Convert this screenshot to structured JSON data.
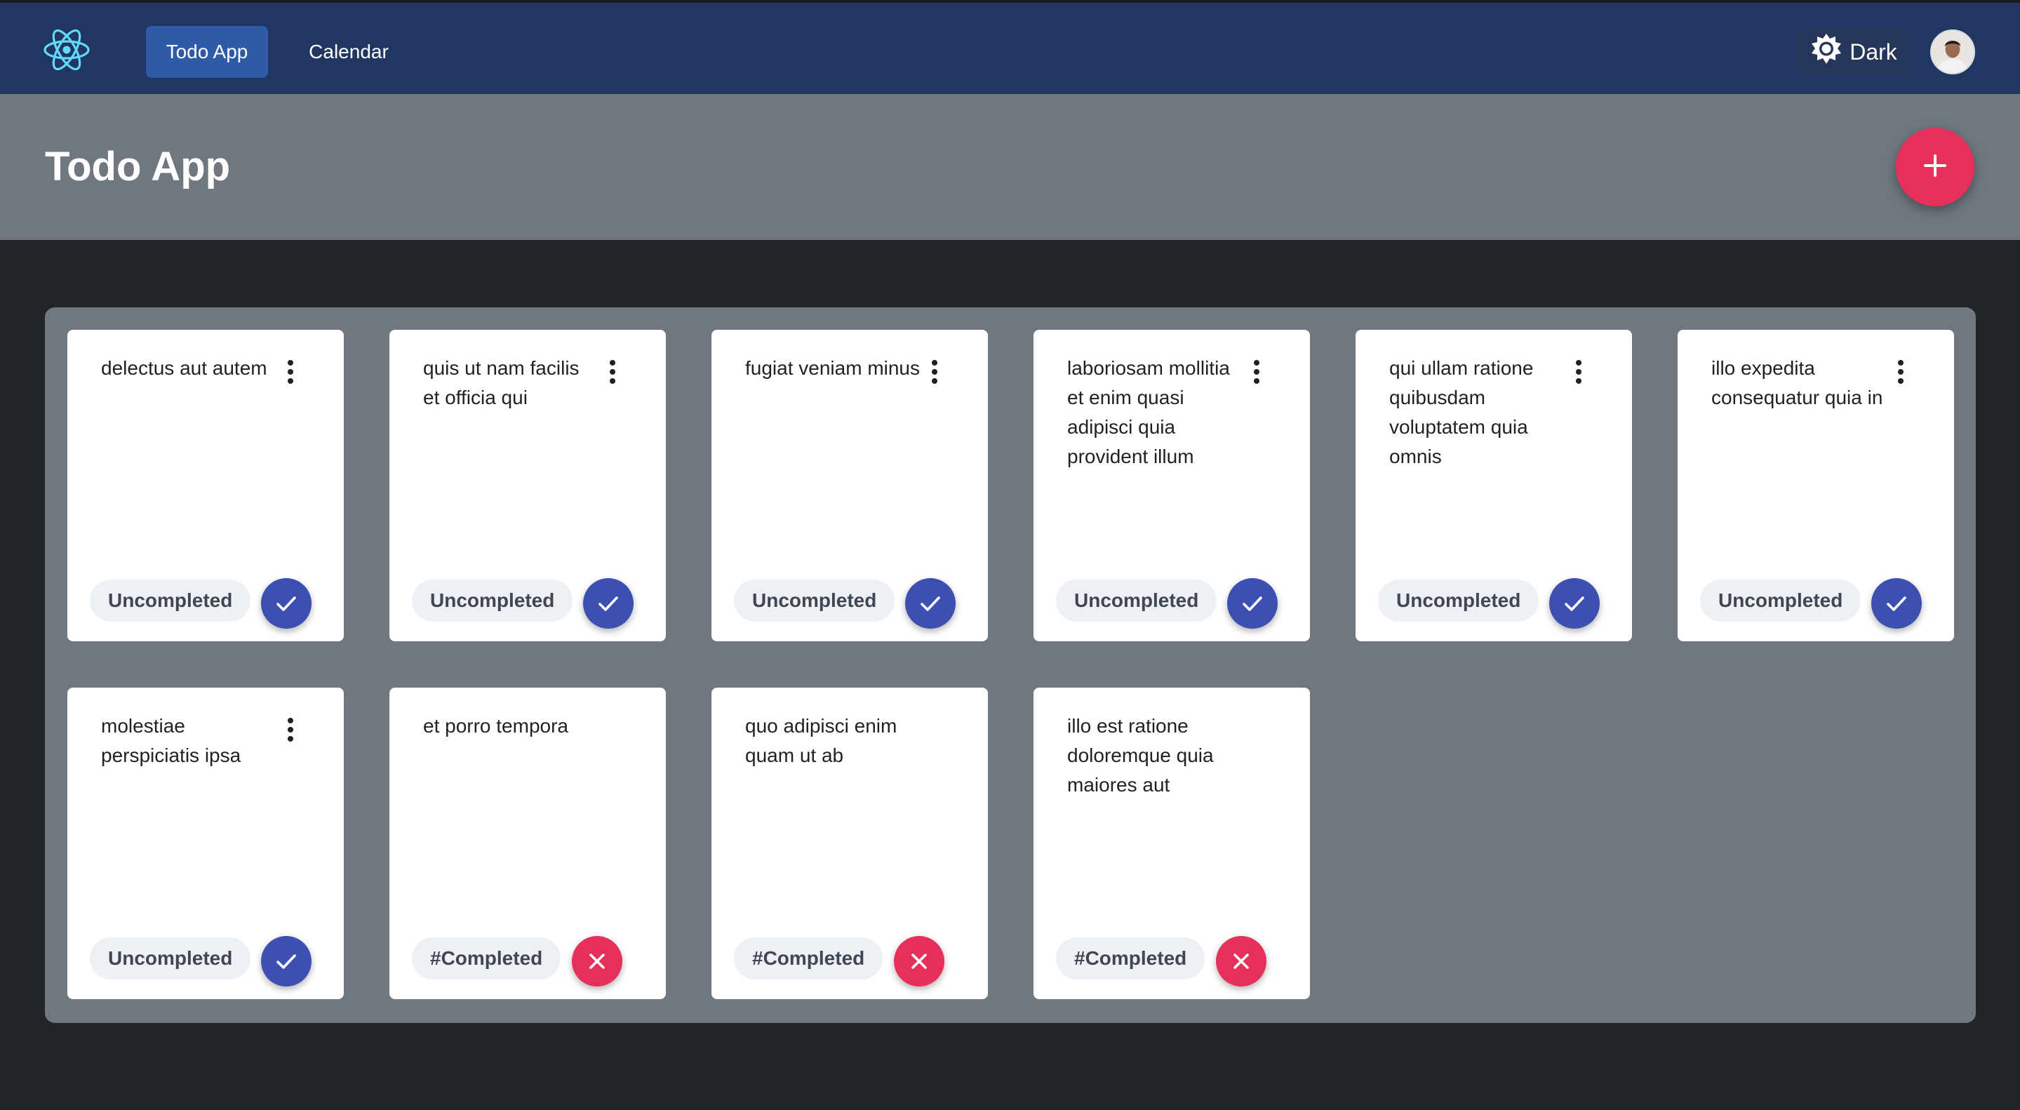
{
  "nav": {
    "items": [
      {
        "label": "Todo App",
        "active": true
      },
      {
        "label": "Calendar",
        "active": false
      }
    ],
    "theme_label": "Dark",
    "logo_icon": "react-atom-icon",
    "theme_icon": "sun-icon"
  },
  "header": {
    "title": "Todo App",
    "add_icon": "plus-icon"
  },
  "colors": {
    "navbar": "#213761",
    "active_nav": "#2e5aa7",
    "header_bg": "#70777f",
    "page_bg": "#212429",
    "accent_red": "#e6305a",
    "accent_blue": "#3d4fb1"
  },
  "todos": [
    {
      "title": "delectus aut autem",
      "status": "Uncompleted",
      "completed": false,
      "has_menu": true
    },
    {
      "title": "quis ut nam facilis et officia qui",
      "status": "Uncompleted",
      "completed": false,
      "has_menu": true
    },
    {
      "title": "fugiat veniam minus",
      "status": "Uncompleted",
      "completed": false,
      "has_menu": true
    },
    {
      "title": "laboriosam mollitia et enim quasi adipisci quia provident illum",
      "status": "Uncompleted",
      "completed": false,
      "has_menu": true
    },
    {
      "title": "qui ullam ratione quibusdam voluptatem quia omnis",
      "status": "Uncompleted",
      "completed": false,
      "has_menu": true
    },
    {
      "title": "illo expedita consequatur quia in",
      "status": "Uncompleted",
      "completed": false,
      "has_menu": true
    },
    {
      "title": "molestiae perspiciatis ipsa",
      "status": "Uncompleted",
      "completed": false,
      "has_menu": true
    },
    {
      "title": "et porro tempora",
      "status": "#Completed",
      "completed": true,
      "has_menu": false
    },
    {
      "title": "quo adipisci enim quam ut ab",
      "status": "#Completed",
      "completed": true,
      "has_menu": false
    },
    {
      "title": "illo est ratione doloremque quia maiores aut",
      "status": "#Completed",
      "completed": true,
      "has_menu": false
    }
  ]
}
